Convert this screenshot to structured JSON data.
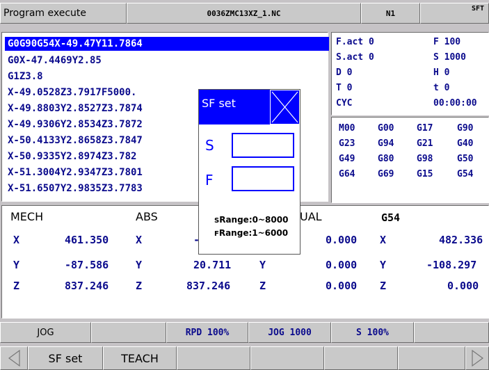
{
  "title": {
    "app": "Program execute",
    "file": "0036ZMC13XZ_1.NC",
    "channel": "N1",
    "mode": "SFT"
  },
  "program": {
    "lines": [
      "G0G90G54X-49.47Y11.7864",
      "G0X-47.4469Y2.85",
      "G1Z3.8",
      "X-49.0528Z3.7917F5000.",
      "X-49.8803Y2.8527Z3.7874",
      "X-49.9306Y2.8534Z3.7872",
      "X-50.4133Y2.8658Z3.7847",
      "X-50.9335Y2.8974Z3.782",
      "X-51.3004Y2.9347Z3.7801",
      "X-51.6507Y2.9835Z3.7783"
    ]
  },
  "status": {
    "rows": [
      {
        "left": "F.act 0",
        "right": "F 100"
      },
      {
        "left": "S.act 0",
        "right": "S 1000"
      },
      {
        "left": "D 0",
        "right": "H 0"
      },
      {
        "left": "T 0",
        "right": "t 0"
      },
      {
        "left": "CYC",
        "right": "00:00:00"
      }
    ],
    "gcodes": [
      [
        "M00",
        "G00",
        "G17",
        "G90"
      ],
      [
        "G23",
        "G94",
        "G21",
        "G40"
      ],
      [
        "G49",
        "G80",
        "G98",
        "G50"
      ],
      [
        "G64",
        "G69",
        "G15",
        "G54"
      ]
    ]
  },
  "coords": {
    "headers": {
      "mech": "MECH",
      "abs": "ABS",
      "residual": "UAL",
      "work": "G54"
    },
    "rows": [
      {
        "axis": "X",
        "mech": "461.350",
        "abs_axis": "X",
        "abs": "-",
        "res_axis": "",
        "res": "0.000",
        "work_axis": "X",
        "work": "482.336"
      },
      {
        "axis": "Y",
        "mech": "-87.586",
        "abs_axis": "Y",
        "abs": "20.711",
        "res_axis": "Y",
        "res": "0.000",
        "work_axis": "Y",
        "work": "-108.297"
      },
      {
        "axis": "Z",
        "mech": "837.246",
        "abs_axis": "Z",
        "abs": "837.246",
        "res_axis": "Z",
        "res": "0.000",
        "work_axis": "Z",
        "work": "0.000"
      }
    ]
  },
  "statusbar": {
    "mode": "JOG",
    "rapid": "RPD 100%",
    "jog": "JOG 1000",
    "spindle": "S 100%"
  },
  "softkeys": {
    "key1": "SF set",
    "key2": "TEACH"
  },
  "dialog": {
    "title": "SF set",
    "s_label": "S",
    "f_label": "F",
    "s_value": "",
    "f_value": "",
    "s_range_prefix": "S",
    "s_range": "Range:0~8000",
    "f_range_prefix": "F",
    "f_range": "Range:1~6000"
  }
}
